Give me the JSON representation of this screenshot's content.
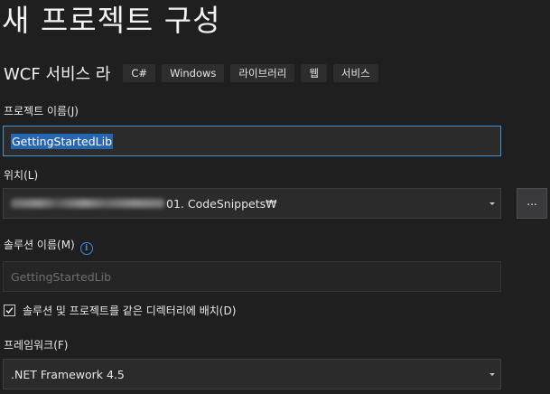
{
  "page": {
    "title": "새 프로젝트 구성"
  },
  "template": {
    "name": "WCF 서비스 라",
    "tags": [
      "C#",
      "Windows",
      "라이브러리",
      "웹",
      "서비스"
    ]
  },
  "project_name": {
    "label": "프로젝트 이름(J)",
    "value": "GettingStartedLib"
  },
  "location": {
    "label": "위치(L)",
    "value_visible_suffix": "01. CodeSnippets₩",
    "browse_label": "..."
  },
  "solution_name": {
    "label": "솔루션 이름(M)",
    "placeholder": "GettingStartedLib",
    "info_icon": "info-icon"
  },
  "same_directory": {
    "label": "솔루션 및 프로젝트를 같은 디렉터리에 배치(D)",
    "checked": true
  },
  "framework": {
    "label": "프레임워크(F)",
    "value": ".NET Framework 4.5"
  },
  "colors": {
    "background": "#1f1f1f",
    "accent": "#3e95d6",
    "selection": "#2666b5"
  }
}
